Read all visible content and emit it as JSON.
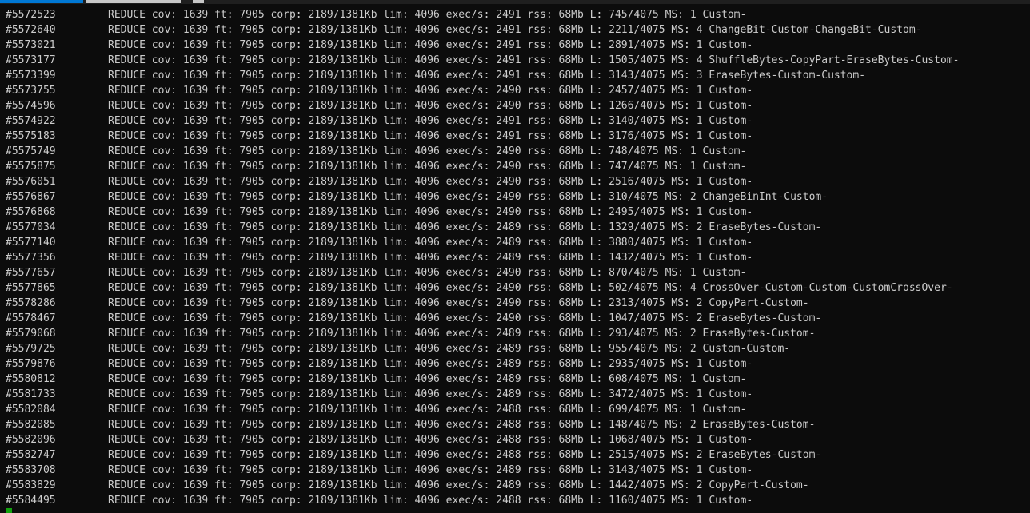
{
  "colors": {
    "background": "#0c0c0c",
    "text": "#cccccc",
    "active_tab": "#0078d4",
    "inactive_tab": "#c8c8c8",
    "cursor": "#13a10e"
  },
  "lines": [
    {
      "seq": "#5572523",
      "msg": "REDUCE cov: 1639 ft: 7905 corp: 2189/1381Kb lim: 4096 exec/s: 2491 rss: 68Mb L: 745/4075 MS: 1 Custom-"
    },
    {
      "seq": "#5572640",
      "msg": "REDUCE cov: 1639 ft: 7905 corp: 2189/1381Kb lim: 4096 exec/s: 2491 rss: 68Mb L: 2211/4075 MS: 4 ChangeBit-Custom-ChangeBit-Custom-"
    },
    {
      "seq": "#5573021",
      "msg": "REDUCE cov: 1639 ft: 7905 corp: 2189/1381Kb lim: 4096 exec/s: 2491 rss: 68Mb L: 2891/4075 MS: 1 Custom-"
    },
    {
      "seq": "#5573177",
      "msg": "REDUCE cov: 1639 ft: 7905 corp: 2189/1381Kb lim: 4096 exec/s: 2491 rss: 68Mb L: 1505/4075 MS: 4 ShuffleBytes-CopyPart-EraseBytes-Custom-"
    },
    {
      "seq": "#5573399",
      "msg": "REDUCE cov: 1639 ft: 7905 corp: 2189/1381Kb lim: 4096 exec/s: 2491 rss: 68Mb L: 3143/4075 MS: 3 EraseBytes-Custom-Custom-"
    },
    {
      "seq": "#5573755",
      "msg": "REDUCE cov: 1639 ft: 7905 corp: 2189/1381Kb lim: 4096 exec/s: 2490 rss: 68Mb L: 2457/4075 MS: 1 Custom-"
    },
    {
      "seq": "#5574596",
      "msg": "REDUCE cov: 1639 ft: 7905 corp: 2189/1381Kb lim: 4096 exec/s: 2490 rss: 68Mb L: 1266/4075 MS: 1 Custom-"
    },
    {
      "seq": "#5574922",
      "msg": "REDUCE cov: 1639 ft: 7905 corp: 2189/1381Kb lim: 4096 exec/s: 2491 rss: 68Mb L: 3140/4075 MS: 1 Custom-"
    },
    {
      "seq": "#5575183",
      "msg": "REDUCE cov: 1639 ft: 7905 corp: 2189/1381Kb lim: 4096 exec/s: 2491 rss: 68Mb L: 3176/4075 MS: 1 Custom-"
    },
    {
      "seq": "#5575749",
      "msg": "REDUCE cov: 1639 ft: 7905 corp: 2189/1381Kb lim: 4096 exec/s: 2490 rss: 68Mb L: 748/4075 MS: 1 Custom-"
    },
    {
      "seq": "#5575875",
      "msg": "REDUCE cov: 1639 ft: 7905 corp: 2189/1381Kb lim: 4096 exec/s: 2490 rss: 68Mb L: 747/4075 MS: 1 Custom-"
    },
    {
      "seq": "#5576051",
      "msg": "REDUCE cov: 1639 ft: 7905 corp: 2189/1381Kb lim: 4096 exec/s: 2490 rss: 68Mb L: 2516/4075 MS: 1 Custom-"
    },
    {
      "seq": "#5576867",
      "msg": "REDUCE cov: 1639 ft: 7905 corp: 2189/1381Kb lim: 4096 exec/s: 2490 rss: 68Mb L: 310/4075 MS: 2 ChangeBinInt-Custom-"
    },
    {
      "seq": "#5576868",
      "msg": "REDUCE cov: 1639 ft: 7905 corp: 2189/1381Kb lim: 4096 exec/s: 2490 rss: 68Mb L: 2495/4075 MS: 1 Custom-"
    },
    {
      "seq": "#5577034",
      "msg": "REDUCE cov: 1639 ft: 7905 corp: 2189/1381Kb lim: 4096 exec/s: 2489 rss: 68Mb L: 1329/4075 MS: 2 EraseBytes-Custom-"
    },
    {
      "seq": "#5577140",
      "msg": "REDUCE cov: 1639 ft: 7905 corp: 2189/1381Kb lim: 4096 exec/s: 2489 rss: 68Mb L: 3880/4075 MS: 1 Custom-"
    },
    {
      "seq": "#5577356",
      "msg": "REDUCE cov: 1639 ft: 7905 corp: 2189/1381Kb lim: 4096 exec/s: 2489 rss: 68Mb L: 1432/4075 MS: 1 Custom-"
    },
    {
      "seq": "#5577657",
      "msg": "REDUCE cov: 1639 ft: 7905 corp: 2189/1381Kb lim: 4096 exec/s: 2490 rss: 68Mb L: 870/4075 MS: 1 Custom-"
    },
    {
      "seq": "#5577865",
      "msg": "REDUCE cov: 1639 ft: 7905 corp: 2189/1381Kb lim: 4096 exec/s: 2490 rss: 68Mb L: 502/4075 MS: 4 CrossOver-Custom-Custom-CustomCrossOver-"
    },
    {
      "seq": "#5578286",
      "msg": "REDUCE cov: 1639 ft: 7905 corp: 2189/1381Kb lim: 4096 exec/s: 2490 rss: 68Mb L: 2313/4075 MS: 2 CopyPart-Custom-"
    },
    {
      "seq": "#5578467",
      "msg": "REDUCE cov: 1639 ft: 7905 corp: 2189/1381Kb lim: 4096 exec/s: 2490 rss: 68Mb L: 1047/4075 MS: 2 EraseBytes-Custom-"
    },
    {
      "seq": "#5579068",
      "msg": "REDUCE cov: 1639 ft: 7905 corp: 2189/1381Kb lim: 4096 exec/s: 2489 rss: 68Mb L: 293/4075 MS: 2 EraseBytes-Custom-"
    },
    {
      "seq": "#5579725",
      "msg": "REDUCE cov: 1639 ft: 7905 corp: 2189/1381Kb lim: 4096 exec/s: 2489 rss: 68Mb L: 955/4075 MS: 2 Custom-Custom-"
    },
    {
      "seq": "#5579876",
      "msg": "REDUCE cov: 1639 ft: 7905 corp: 2189/1381Kb lim: 4096 exec/s: 2489 rss: 68Mb L: 2935/4075 MS: 1 Custom-"
    },
    {
      "seq": "#5580812",
      "msg": "REDUCE cov: 1639 ft: 7905 corp: 2189/1381Kb lim: 4096 exec/s: 2489 rss: 68Mb L: 608/4075 MS: 1 Custom-"
    },
    {
      "seq": "#5581733",
      "msg": "REDUCE cov: 1639 ft: 7905 corp: 2189/1381Kb lim: 4096 exec/s: 2489 rss: 68Mb L: 3472/4075 MS: 1 Custom-"
    },
    {
      "seq": "#5582084",
      "msg": "REDUCE cov: 1639 ft: 7905 corp: 2189/1381Kb lim: 4096 exec/s: 2488 rss: 68Mb L: 699/4075 MS: 1 Custom-"
    },
    {
      "seq": "#5582085",
      "msg": "REDUCE cov: 1639 ft: 7905 corp: 2189/1381Kb lim: 4096 exec/s: 2488 rss: 68Mb L: 148/4075 MS: 2 EraseBytes-Custom-"
    },
    {
      "seq": "#5582096",
      "msg": "REDUCE cov: 1639 ft: 7905 corp: 2189/1381Kb lim: 4096 exec/s: 2488 rss: 68Mb L: 1068/4075 MS: 1 Custom-"
    },
    {
      "seq": "#5582747",
      "msg": "REDUCE cov: 1639 ft: 7905 corp: 2189/1381Kb lim: 4096 exec/s: 2488 rss: 68Mb L: 2515/4075 MS: 2 EraseBytes-Custom-"
    },
    {
      "seq": "#5583708",
      "msg": "REDUCE cov: 1639 ft: 7905 corp: 2189/1381Kb lim: 4096 exec/s: 2489 rss: 68Mb L: 3143/4075 MS: 1 Custom-"
    },
    {
      "seq": "#5583829",
      "msg": "REDUCE cov: 1639 ft: 7905 corp: 2189/1381Kb lim: 4096 exec/s: 2489 rss: 68Mb L: 1442/4075 MS: 2 CopyPart-Custom-"
    },
    {
      "seq": "#5584495",
      "msg": "REDUCE cov: 1639 ft: 7905 corp: 2189/1381Kb lim: 4096 exec/s: 2488 rss: 68Mb L: 1160/4075 MS: 1 Custom-"
    }
  ]
}
